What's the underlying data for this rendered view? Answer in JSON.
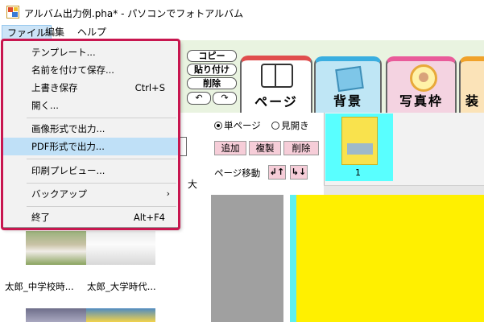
{
  "window": {
    "title": "アルバム出力例.pha* - パソコンでフォトアルバム"
  },
  "menubar": {
    "file": "ファイル",
    "edit": "編集",
    "help": "ヘルプ"
  },
  "file_menu": {
    "items": [
      {
        "label": "テンプレート...",
        "shortcut": ""
      },
      {
        "label": "名前を付けて保存...",
        "shortcut": ""
      },
      {
        "label": "上書き保存",
        "shortcut": "Ctrl+S"
      },
      {
        "label": "開く...",
        "shortcut": ""
      },
      {
        "label": "画像形式で出力...",
        "shortcut": ""
      },
      {
        "label": "PDF形式で出力...",
        "shortcut": "",
        "highlighted": true
      },
      {
        "label": "印刷プレビュー...",
        "shortcut": ""
      },
      {
        "label": "バックアップ",
        "shortcut": "",
        "submenu": true
      },
      {
        "label": "終了",
        "shortcut": "Alt+F4"
      }
    ],
    "submenu_arrow": "›"
  },
  "edit_buttons": {
    "copy": "コピー",
    "paste": "貼り付け",
    "delete": "削除",
    "undo": "↶",
    "redo": "↷"
  },
  "tabs": {
    "page": "ページ",
    "background": "背景",
    "photo_frame": "写真枠",
    "decoration": "装"
  },
  "page_panel": {
    "single_page": "単ページ",
    "spread": "見開き",
    "add": "追加",
    "duplicate": "複製",
    "delete": "削除",
    "move_label": "ページ移動",
    "move_up": "↲↑",
    "move_down": "↳↓",
    "page_number": "1"
  },
  "left_panel": {
    "size_label": "大",
    "thumbnails": [
      {
        "caption": "太郎_中学校時..."
      },
      {
        "caption": "太郎_大学時代..."
      }
    ]
  },
  "colors": {
    "menu_highlight": "#bfe0f7",
    "frame": "#c8164f",
    "canvas": "#fff000",
    "page_tab_accent": "#e04d4d"
  }
}
